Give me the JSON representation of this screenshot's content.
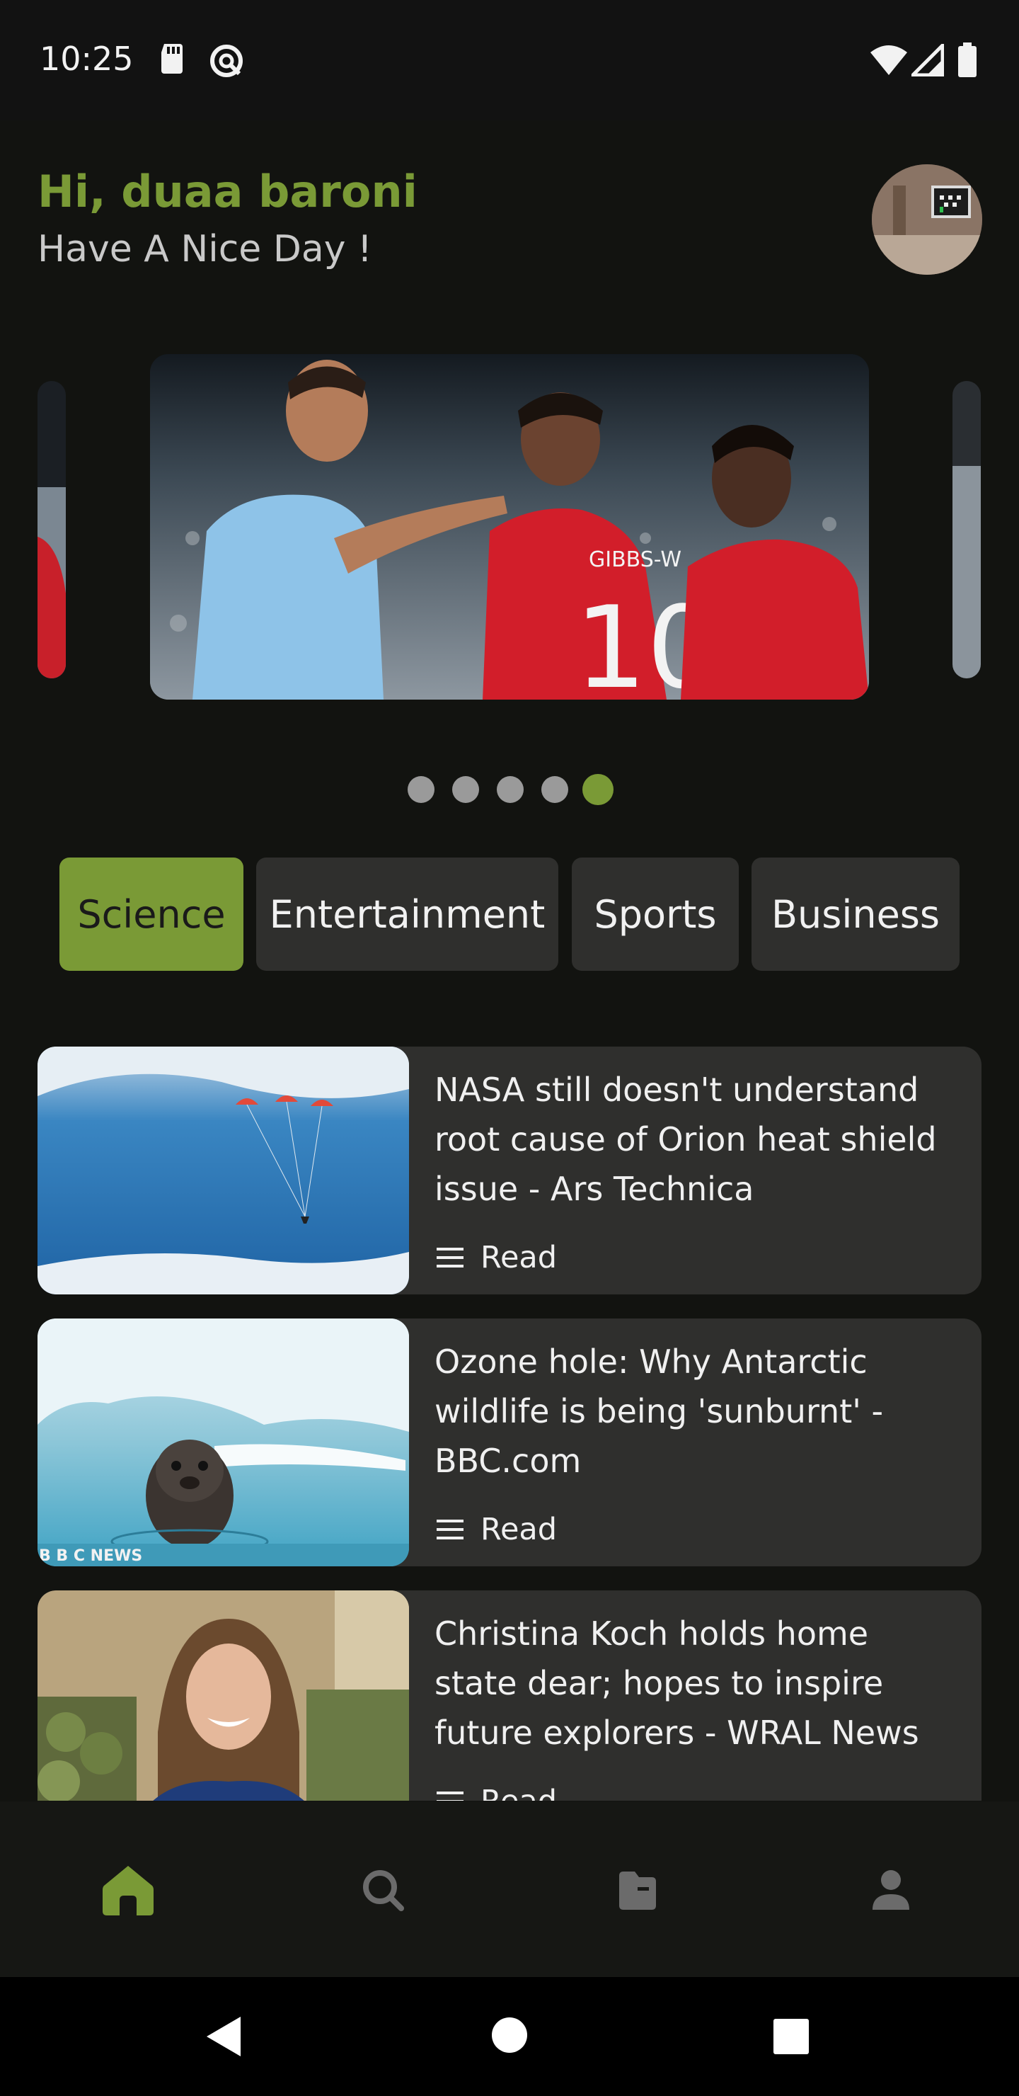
{
  "status_bar": {
    "time": "10:25",
    "left_icons": [
      "sd-card-icon",
      "data-saver-icon"
    ],
    "right_icons": [
      "wifi-icon",
      "cell-signal-icon",
      "battery-icon"
    ]
  },
  "header": {
    "greeting": "Hi, duaa baroni",
    "subtitle": "Have A Nice Day !",
    "avatar_icon": "profile-avatar"
  },
  "carousel": {
    "slide_count": 5,
    "active_index": 4
  },
  "categories": [
    {
      "label": "Science",
      "active": true
    },
    {
      "label": "Entertainment",
      "active": false
    },
    {
      "label": "Sports",
      "active": false
    },
    {
      "label": "Business",
      "active": false
    }
  ],
  "news": [
    {
      "title": "NASA still doesn't understand root cause of Orion heat shield issue - Ars Technica",
      "read_label": "Read"
    },
    {
      "title": "Ozone hole: Why Antarctic wildlife is being 'sunburnt' - BBC.com",
      "read_label": "Read",
      "image_watermark": "B B C NEWS"
    },
    {
      "title": "Christina Koch holds home state dear; hopes to inspire future explorers - WRAL News",
      "read_label": "Read"
    }
  ],
  "bottom_nav": [
    {
      "icon": "home-icon",
      "active": true
    },
    {
      "icon": "search-icon",
      "active": false
    },
    {
      "icon": "folder-icon",
      "active": false
    },
    {
      "icon": "person-icon",
      "active": false
    }
  ],
  "colors": {
    "accent": "#7a9a36",
    "background": "#121310",
    "card": "#2f2f2d"
  }
}
